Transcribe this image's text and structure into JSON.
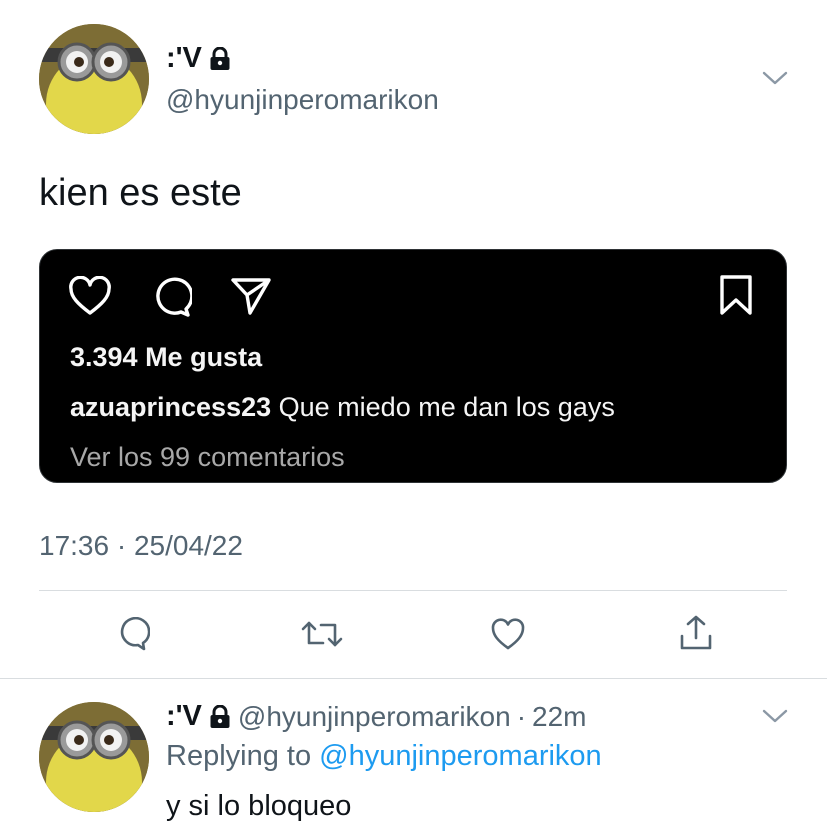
{
  "tweet": {
    "display_name": ":'V",
    "handle": "@hyunjinperomarikon",
    "text": "kien es este",
    "timestamp": "17:36 · 25/04/22",
    "instagram_embed": {
      "likes": "3.394 Me gusta",
      "caption_user": "azuaprincess23",
      "caption_text": "Que miedo me dan los gays",
      "comments_link": "Ver los 99 comentarios"
    },
    "actions": [
      {
        "name": "reply",
        "icon": "comment-icon"
      },
      {
        "name": "retweet",
        "icon": "retweet-icon"
      },
      {
        "name": "like",
        "icon": "heart-icon"
      },
      {
        "name": "share",
        "icon": "share-icon"
      }
    ]
  },
  "reply": {
    "display_name": ":'V",
    "handle": "@hyunjinperomarikon",
    "separator": "·",
    "time": "22m",
    "replying_prefix": "Replying to",
    "replying_to": "@hyunjinperomarikon",
    "text": "y si lo bloqueo"
  },
  "colors": {
    "text": "#0f1419",
    "secondary": "#536471",
    "link": "#1d9bf0",
    "divider": "#d9dde0",
    "embed_bg": "#000000"
  }
}
